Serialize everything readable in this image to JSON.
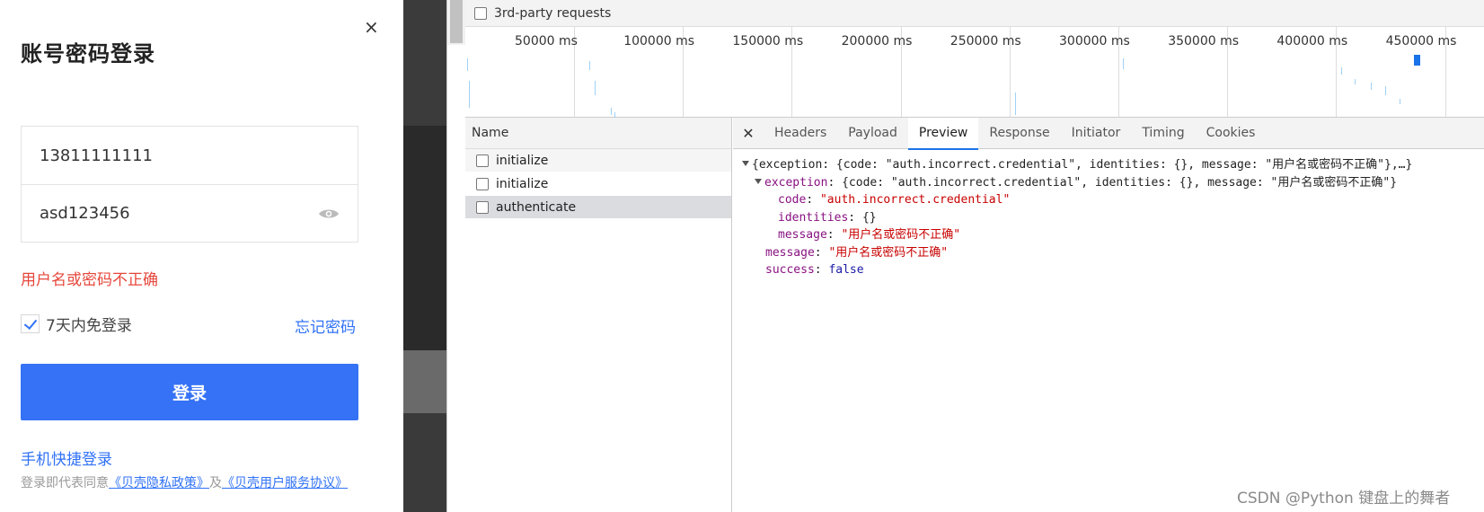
{
  "login": {
    "title": "账号密码登录",
    "close": "×",
    "username": "13811111111",
    "password": "asd123456",
    "error": "用户名或密码不正确",
    "remember_label": "7天内免登录",
    "forgot": "忘记密码",
    "submit": "登录",
    "quick_login": "手机快捷登录",
    "agree_prefix": "登录即代表同意",
    "privacy_link": "《贝壳隐私政策》",
    "agree_and": "及",
    "terms_link": "《贝壳用户服务协议》"
  },
  "devtools": {
    "filter_label": "3rd-party requests",
    "timeline_ticks": [
      "50000 ms",
      "100000 ms",
      "150000 ms",
      "200000 ms",
      "250000 ms",
      "300000 ms",
      "350000 ms",
      "400000 ms",
      "450000 ms"
    ],
    "names_header": "Name",
    "requests": [
      {
        "name": "initialize",
        "state": "alt"
      },
      {
        "name": "initialize",
        "state": ""
      },
      {
        "name": "authenticate",
        "state": "sel"
      }
    ],
    "tabs": [
      "Headers",
      "Payload",
      "Preview",
      "Response",
      "Initiator",
      "Timing",
      "Cookies"
    ],
    "active_tab": "Preview",
    "preview": {
      "summary": "{exception: {code: \"auth.incorrect.credential\", identities: {}, message: \"用户名或密码不正确\"},…}",
      "exception_summary": "{code: \"auth.incorrect.credential\", identities: {}, message: \"用户名或密码不正确\"}",
      "code_value": "\"auth.incorrect.credential\"",
      "identities_value": "{}",
      "exception_message_value": "\"用户名或密码不正确\"",
      "message_value": "\"用户名或密码不正确\"",
      "success_value": "false"
    }
  },
  "watermark": "CSDN @Python 键盘上的舞者"
}
